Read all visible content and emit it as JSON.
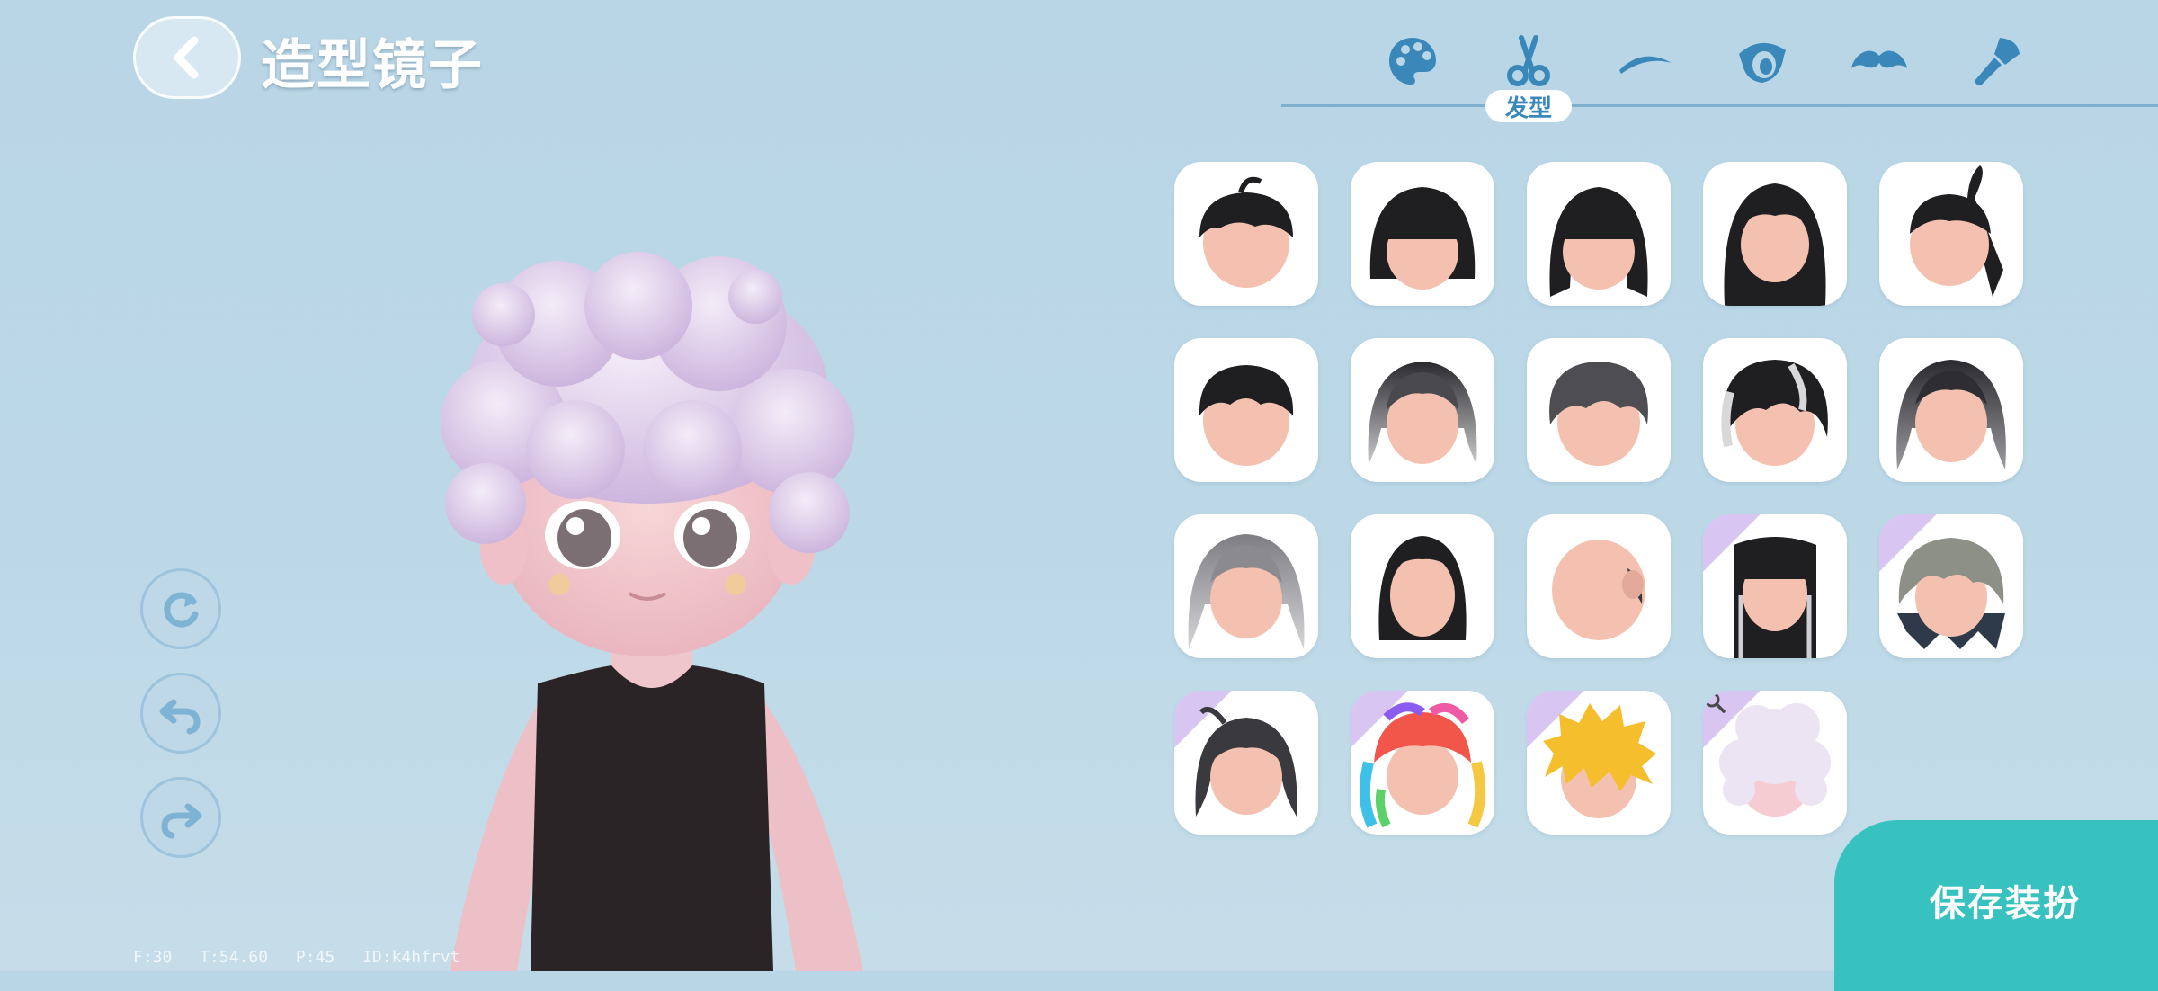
{
  "header": {
    "title": "造型镜子"
  },
  "tabs": [
    {
      "name": "palette-icon",
      "label": "",
      "active": false
    },
    {
      "name": "scissors-icon",
      "label": "发型",
      "active": true
    },
    {
      "name": "eyebrow-icon",
      "label": "",
      "active": false
    },
    {
      "name": "eye-icon",
      "label": "",
      "active": false
    },
    {
      "name": "mustache-icon",
      "label": "",
      "active": false
    },
    {
      "name": "brush-icon",
      "label": "",
      "active": false
    }
  ],
  "active_tab_label": "发型",
  "hair_options": [
    {
      "style": "short-black-tuft",
      "rare": false
    },
    {
      "style": "black-bob-bangs",
      "rare": false
    },
    {
      "style": "black-bangs-shoulder",
      "rare": false
    },
    {
      "style": "long-black",
      "rare": false
    },
    {
      "style": "black-ponytail",
      "rare": false
    },
    {
      "style": "short-black",
      "rare": false
    },
    {
      "style": "gray-gradient-wavy",
      "rare": false
    },
    {
      "style": "dark-gray-messy",
      "rare": false
    },
    {
      "style": "black-white-streak",
      "rare": false
    },
    {
      "style": "dark-gray-wavy",
      "rare": false
    },
    {
      "style": "silver-long-wavy",
      "rare": false
    },
    {
      "style": "black-straight-bob",
      "rare": false
    },
    {
      "style": "bald",
      "rare": false
    },
    {
      "style": "black-hime-streaks",
      "rare": true
    },
    {
      "style": "gray-green-layered",
      "rare": true
    },
    {
      "style": "dark-gray-side",
      "rare": true
    },
    {
      "style": "rainbow-twintails",
      "rare": true
    },
    {
      "style": "golden-spiky",
      "rare": true
    },
    {
      "style": "lavender-curly",
      "rare": true,
      "selected": true
    }
  ],
  "controls": {
    "reset_icon": "reset-icon",
    "undo_icon": "undo-icon",
    "redo_icon": "redo-icon"
  },
  "save_label": "保存装扮",
  "debug_text": "F:30 T:54.60 P:45 ID:k4hfrvt",
  "colors": {
    "accent": "#3a88b9",
    "save": "#37c2bf",
    "background": "#b9d6e6"
  }
}
